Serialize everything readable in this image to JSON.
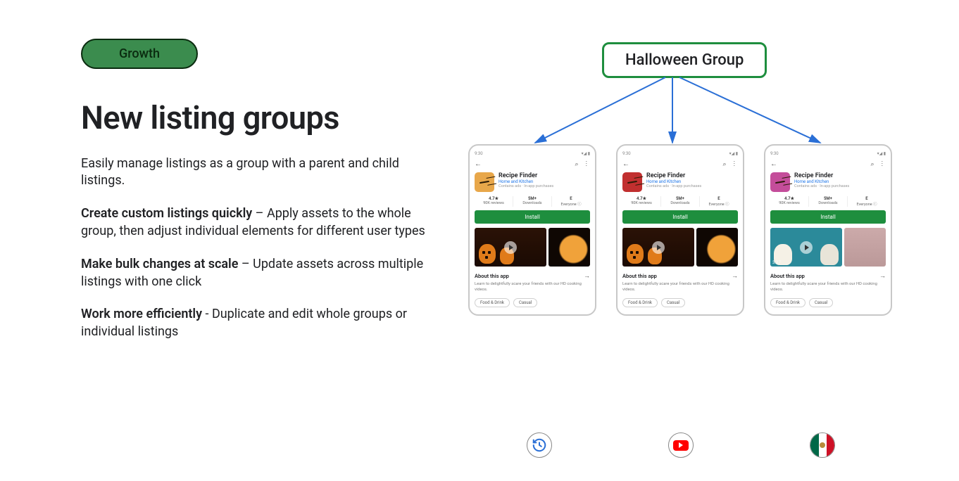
{
  "pill": "Growth",
  "heading": "New listing groups",
  "description": "Easily manage listings as a group with a parent and child listings.",
  "bullets": [
    {
      "title": "Create custom listings quickly",
      "sep": " – ",
      "body": "Apply assets to the whole group, then adjust individual elements for different user types"
    },
    {
      "title": "Make bulk changes at scale",
      "sep": " – ",
      "body": "Update assets across multiple listings with one click"
    },
    {
      "title": "Work more efficiently",
      "sep": " - ",
      "body": "Duplicate and edit whole groups or individual listings"
    }
  ],
  "group_label": "Halloween Group",
  "listing": {
    "time": "9:30",
    "app_name": "Recipe Finder",
    "category": "Home and Kitchen",
    "subinfo": "Contains ads · In-app purchases",
    "stats": {
      "rating": "4.7★",
      "rating_sub": "90K reviews",
      "downloads": "5M+",
      "downloads_sub": "Downloads",
      "age": "E",
      "age_sub": "Everyone ⓘ"
    },
    "install": "Install",
    "video_duration": "3:27",
    "about_title": "About this app",
    "about_text": "Learn to delightfully scare your friends with our HD cooking videos.",
    "tags": [
      "Food & Drink",
      "Casual"
    ]
  },
  "badges": [
    "history",
    "youtube",
    "mexico-flag"
  ],
  "icon_variants": [
    "orange",
    "red",
    "magenta"
  ],
  "media_variants": [
    "halloween",
    "halloween",
    "skulls"
  ]
}
